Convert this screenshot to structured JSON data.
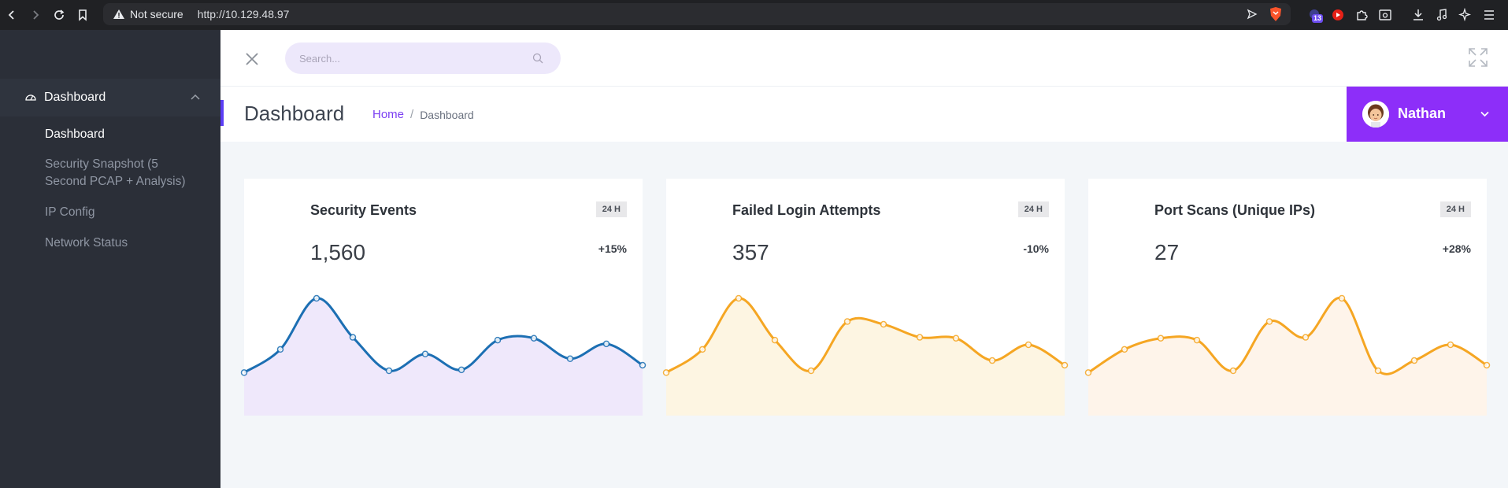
{
  "browser": {
    "not_secure": "Not secure",
    "url": "http://10.129.48.97",
    "extension_badge": "13"
  },
  "sidebar": {
    "section_label": "Dashboard",
    "items": [
      {
        "label": "Dashboard",
        "active": true
      },
      {
        "label": "Security Snapshot (5 Second PCAP + Analysis)",
        "active": false
      },
      {
        "label": "IP Config",
        "active": false
      },
      {
        "label": "Network Status",
        "active": false
      }
    ]
  },
  "topbar": {
    "search_placeholder": "Search..."
  },
  "page_header": {
    "title": "Dashboard",
    "breadcrumb_home": "Home",
    "breadcrumb_separator": "/",
    "breadcrumb_current": "Dashboard"
  },
  "user": {
    "name": "Nathan"
  },
  "colors": {
    "accent_purple": "#8d2ef9",
    "sidebar_bg": "#2b2f38",
    "blue_series": "#1c6fb3",
    "orange_series": "#f5a623"
  },
  "cards": [
    {
      "title": "Security Events",
      "badge": "24 H",
      "value": "1,560",
      "change": "+15%"
    },
    {
      "title": "Failed Login Attempts",
      "badge": "24 H",
      "value": "357",
      "change": "-10%"
    },
    {
      "title": "Port Scans (Unique IPs)",
      "badge": "24 H",
      "value": "27",
      "change": "+28%"
    }
  ],
  "chart_data": [
    {
      "type": "area",
      "title": "",
      "color": "#1c6fb3",
      "fill": "#efe8fb",
      "ylim": [
        0,
        100
      ],
      "values": [
        20,
        45,
        100,
        58,
        22,
        40,
        23,
        55,
        57,
        35,
        51,
        28
      ]
    },
    {
      "type": "area",
      "title": "",
      "color": "#f5a623",
      "fill": "#fdf5e2",
      "ylim": [
        0,
        100
      ],
      "values": [
        20,
        45,
        100,
        55,
        22,
        75,
        72,
        58,
        57,
        33,
        50,
        28
      ]
    },
    {
      "type": "area",
      "title": "",
      "color": "#f5a623",
      "fill": "#fef4ea",
      "ylim": [
        0,
        100
      ],
      "values": [
        20,
        45,
        57,
        55,
        22,
        75,
        58,
        100,
        22,
        33,
        50,
        28
      ]
    }
  ]
}
